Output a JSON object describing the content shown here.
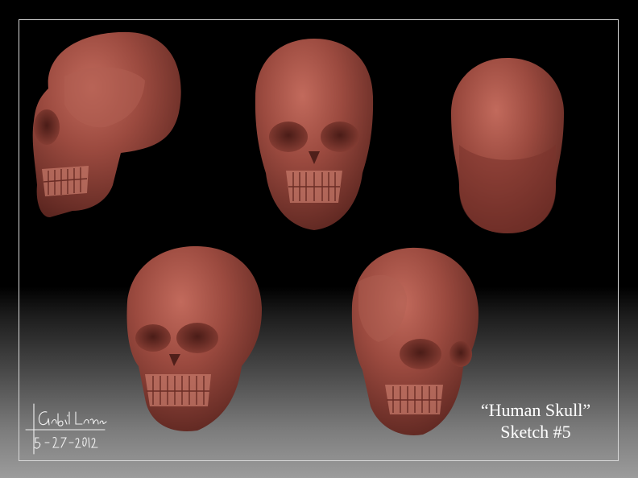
{
  "caption": {
    "title": "“Human Skull”",
    "subtitle": "Sketch #5"
  },
  "signature": {
    "name": "Gabriel Lamas",
    "date": "5-27-2012"
  },
  "colors": {
    "skull": "#9a4a3f",
    "frame": "#d9d9d9",
    "background_top": "#000000",
    "background_bottom": "#9c9c9c"
  },
  "views": [
    "side",
    "front",
    "top",
    "three-quarter-left",
    "three-quarter-right"
  ]
}
